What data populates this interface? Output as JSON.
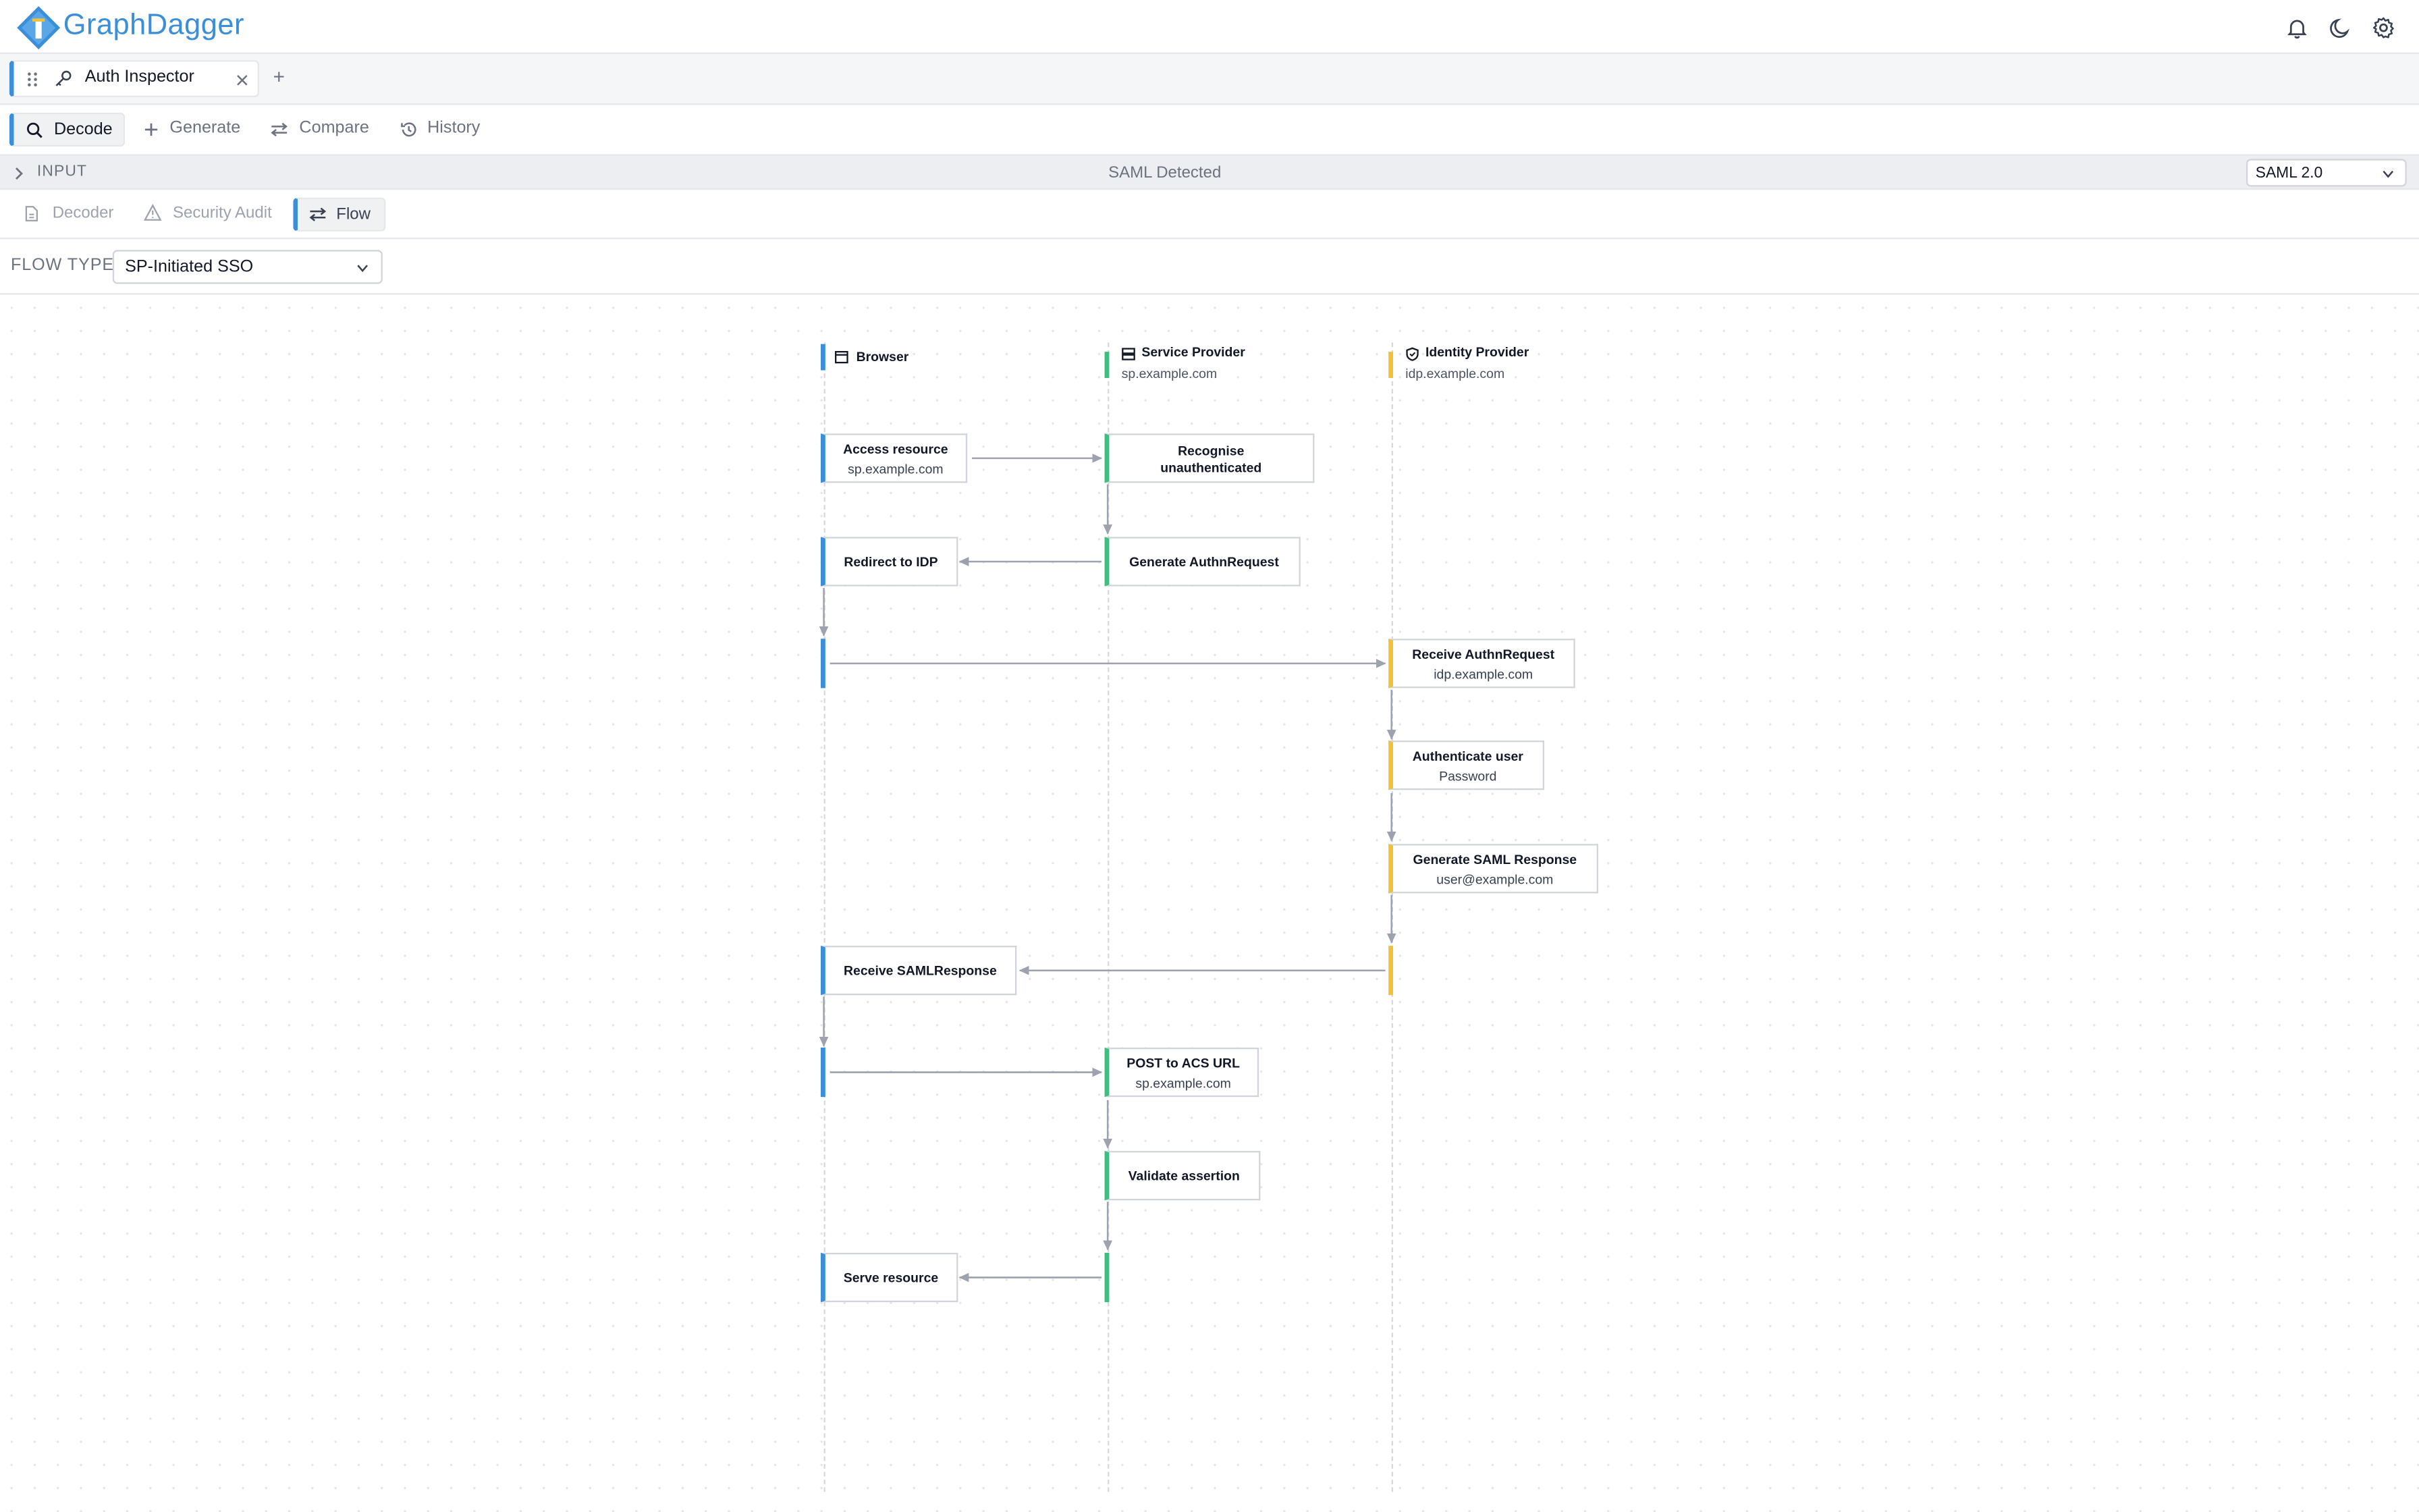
{
  "app": {
    "brand": "GraphDagger"
  },
  "header": {
    "icons": [
      "bell-icon",
      "moon-icon",
      "gear-icon"
    ]
  },
  "window_tab": {
    "label": "Auth Inspector",
    "icons": [
      "drag-handle-icon",
      "key-icon",
      "close-icon"
    ],
    "add_label": "+"
  },
  "toolbar": {
    "items": [
      {
        "label": "Decode",
        "icon": "search-icon",
        "active": true
      },
      {
        "label": "Generate",
        "icon": "plus-icon",
        "active": false
      },
      {
        "label": "Compare",
        "icon": "swap-icon",
        "active": false
      },
      {
        "label": "History",
        "icon": "history-icon",
        "active": false
      }
    ]
  },
  "input_bar": {
    "label": "INPUT",
    "detected": "SAML Detected",
    "protocol": "SAML 2.0"
  },
  "sub_tabs": {
    "items": [
      {
        "label": "Decoder",
        "icon": "document-icon",
        "active": false
      },
      {
        "label": "Security Audit",
        "icon": "warning-icon",
        "active": false
      },
      {
        "label": "Flow",
        "icon": "swap-icon",
        "active": true
      }
    ]
  },
  "flow": {
    "label": "FLOW TYPE",
    "type": "SP-Initiated SSO"
  },
  "colors": {
    "accent": "#3b8fd9",
    "browser": "#3b8fd9",
    "service_provider": "#3dbf80",
    "identity_provider": "#f0c23a"
  },
  "lanes": [
    {
      "name": "Browser",
      "host": "",
      "icon": "browser-icon"
    },
    {
      "name": "Service Provider",
      "host": "sp.example.com",
      "icon": "server-icon"
    },
    {
      "name": "Identity Provider",
      "host": "idp.example.com",
      "icon": "shield-icon"
    }
  ],
  "steps": [
    {
      "lane": "Browser",
      "title": "Access resource",
      "detail": "sp.example.com"
    },
    {
      "lane": "Service Provider",
      "title": "Recognise unauthenticated",
      "detail": ""
    },
    {
      "lane": "Service Provider",
      "title": "Generate AuthnRequest",
      "detail": ""
    },
    {
      "lane": "Browser",
      "title": "Redirect to IDP",
      "detail": ""
    },
    {
      "lane": "Identity Provider",
      "title": "Receive AuthnRequest",
      "detail": "idp.example.com"
    },
    {
      "lane": "Identity Provider",
      "title": "Authenticate user",
      "detail": "Password"
    },
    {
      "lane": "Identity Provider",
      "title": "Generate SAML Response",
      "detail": "user@example.com"
    },
    {
      "lane": "Browser",
      "title": "Receive SAMLResponse",
      "detail": ""
    },
    {
      "lane": "Service Provider",
      "title": "POST to ACS URL",
      "detail": "sp.example.com"
    },
    {
      "lane": "Service Provider",
      "title": "Validate assertion",
      "detail": ""
    },
    {
      "lane": "Browser",
      "title": "Serve resource",
      "detail": ""
    }
  ]
}
